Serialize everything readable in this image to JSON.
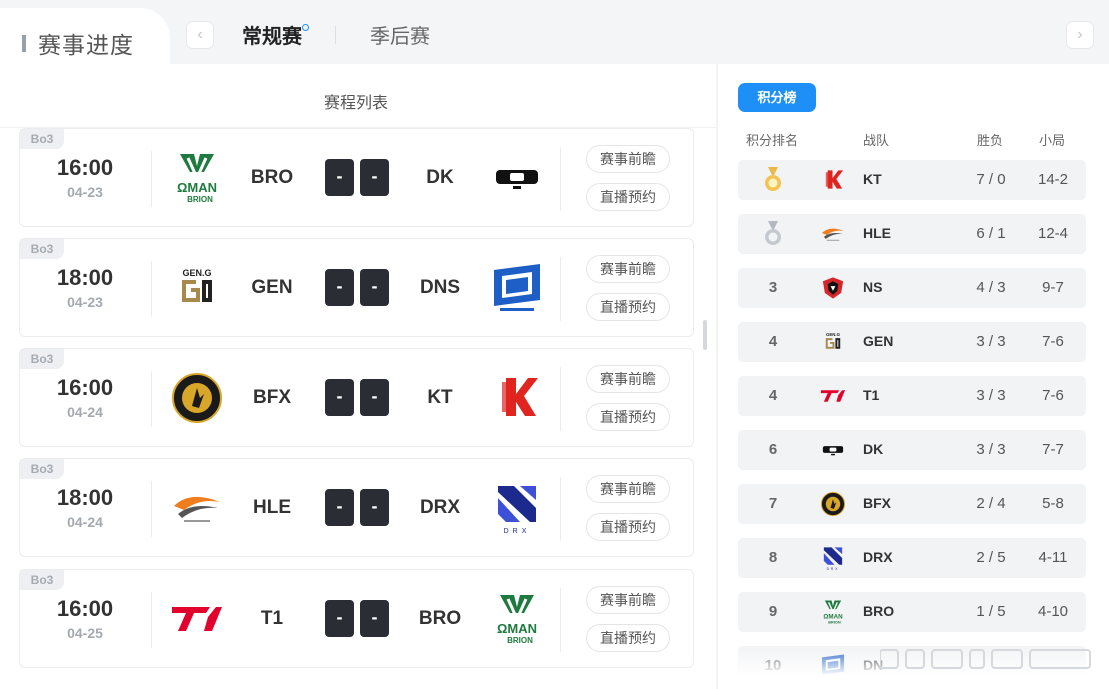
{
  "header": {
    "section_title": "赛事进度",
    "prev_icon": "chevron-left-icon",
    "next_icon": "chevron-right-icon",
    "tabs": [
      {
        "label": "常规赛",
        "active": true
      },
      {
        "label": "季后赛",
        "active": false
      }
    ]
  },
  "schedule": {
    "title": "赛程列表",
    "matches": [
      {
        "format": "Bo3",
        "time": "16:00",
        "date": "04-23",
        "home": "BRO",
        "home_score": "-",
        "away_score": "-",
        "away": "DK",
        "preview_label": "赛事前瞻",
        "book_label": "直播预约"
      },
      {
        "format": "Bo3",
        "time": "18:00",
        "date": "04-23",
        "home": "GEN",
        "home_score": "-",
        "away_score": "-",
        "away": "DNS",
        "preview_label": "赛事前瞻",
        "book_label": "直播预约"
      },
      {
        "format": "Bo3",
        "time": "16:00",
        "date": "04-24",
        "home": "BFX",
        "home_score": "-",
        "away_score": "-",
        "away": "KT",
        "preview_label": "赛事前瞻",
        "book_label": "直播预约"
      },
      {
        "format": "Bo3",
        "time": "18:00",
        "date": "04-24",
        "home": "HLE",
        "home_score": "-",
        "away_score": "-",
        "away": "DRX",
        "preview_label": "赛事前瞻",
        "book_label": "直播预约"
      },
      {
        "format": "Bo3",
        "time": "16:00",
        "date": "04-25",
        "home": "T1",
        "home_score": "-",
        "away_score": "-",
        "away": "BRO",
        "preview_label": "赛事前瞻",
        "book_label": "直播预约"
      }
    ]
  },
  "standings": {
    "tab_label": "积分榜",
    "columns": {
      "rank": "积分排名",
      "team": "战队",
      "wl": "胜负",
      "games": "小局"
    },
    "rows": [
      {
        "rank": "",
        "medal": "gold",
        "team": "KT",
        "wl": "7 / 0",
        "games": "14-2"
      },
      {
        "rank": "",
        "medal": "silver",
        "team": "HLE",
        "wl": "6 / 1",
        "games": "12-4"
      },
      {
        "rank": "3",
        "team": "NS",
        "wl": "4 / 3",
        "games": "9-7"
      },
      {
        "rank": "4",
        "team": "GEN",
        "wl": "3 / 3",
        "games": "7-6"
      },
      {
        "rank": "4",
        "team": "T1",
        "wl": "3 / 3",
        "games": "7-6"
      },
      {
        "rank": "6",
        "team": "DK",
        "wl": "3 / 3",
        "games": "7-7"
      },
      {
        "rank": "7",
        "team": "BFX",
        "wl": "2 / 4",
        "games": "5-8"
      },
      {
        "rank": "8",
        "team": "DRX",
        "wl": "2 / 5",
        "games": "4-11"
      },
      {
        "rank": "9",
        "team": "BRO",
        "wl": "1 / 5",
        "games": "4-10"
      },
      {
        "rank": "10",
        "team": "DN",
        "wl": "",
        "games": ""
      }
    ]
  },
  "colors": {
    "accent": "#1e8ff6",
    "score_box": "#2a2d33",
    "row_bg": "#f2f3f5",
    "bro_green": "#1e7a3e",
    "gen_gold": "#a8894d",
    "kt_red": "#e0241f",
    "t1_red": "#e2012d",
    "dns_blue": "#1d5fc6",
    "drx_navy": "#1b2a8c"
  }
}
